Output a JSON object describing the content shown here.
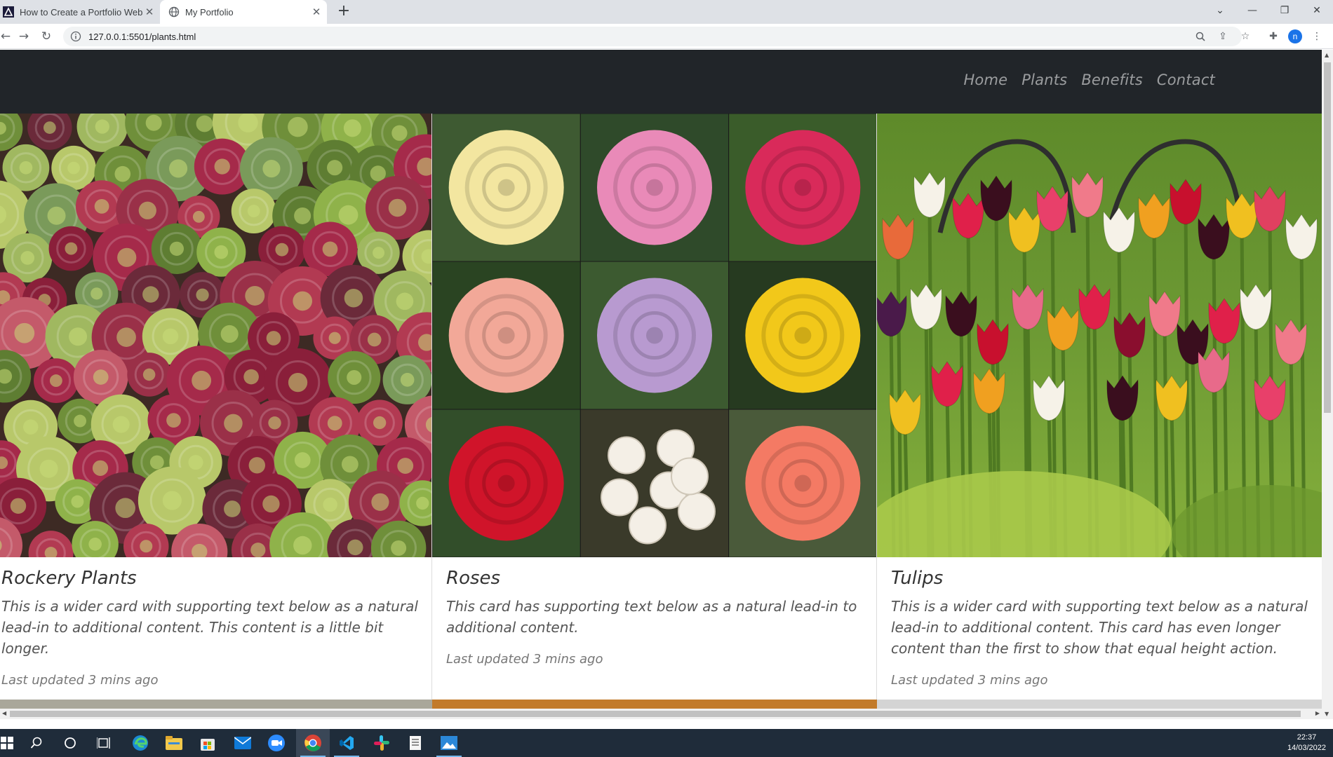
{
  "browser": {
    "tabs": [
      {
        "title": "How to Create a Portfolio Websit",
        "icon": "brand-logo-icon",
        "active": false
      },
      {
        "title": "My Portfolio",
        "icon": "globe-icon",
        "active": true
      }
    ],
    "url": "127.0.0.1:5501/plants.html",
    "profile_initial": "n"
  },
  "navbar": {
    "links": [
      "Home",
      "Plants",
      "Benefits",
      "Contact"
    ],
    "background": "#212529"
  },
  "cards": [
    {
      "title": "Rockery Plants",
      "text": "This is a wider card with supporting text below as a natural lead-in to additional content. This content is a little bit longer.",
      "meta": "Last updated 3 mins ago",
      "image": "succulents-photo"
    },
    {
      "title": "Roses",
      "text": "This card has supporting text below as a natural lead-in to additional content.",
      "meta": "Last updated 3 mins ago",
      "image": "roses-collage-photo"
    },
    {
      "title": "Tulips",
      "text": "This is a wider card with supporting text below as a natural lead-in to additional content. This card has even longer content than the first to show that equal height action.",
      "meta": "Last updated 3 mins ago",
      "image": "tulips-photo"
    }
  ],
  "taskbar": {
    "time": "22:37",
    "date": "14/03/2022"
  }
}
